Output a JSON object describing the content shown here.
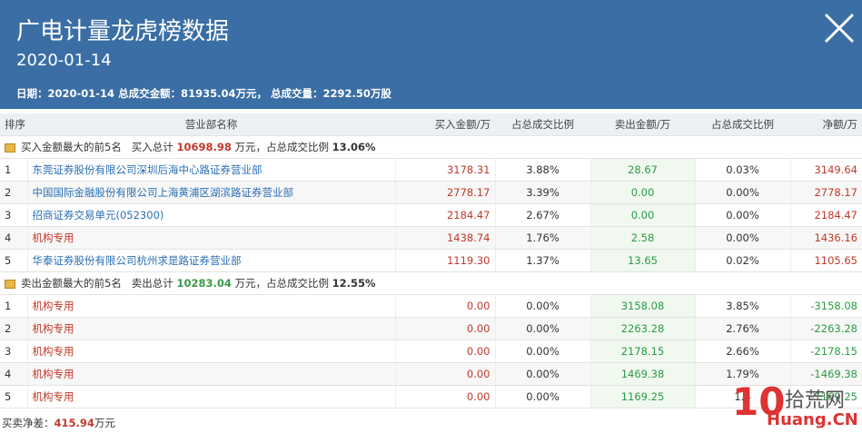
{
  "header": {
    "title": "广电计量龙虎榜数据",
    "date": "2020-01-14",
    "summary": "日期：2020-01-14 总成交金额：81935.04万元， 总成交量：2292.50万股"
  },
  "columns": [
    "排序",
    "营业部名称",
    "买入金额/万",
    "占总成交比例",
    "卖出金额/万",
    "占总成交比例",
    "净额/万"
  ],
  "buy_section": {
    "label": "买入金额最大的前5名",
    "total_prefix": "买入总计",
    "total": "10698.98",
    "total_suffix": "万元，占总成交比例",
    "ratio": "13.06%"
  },
  "buy_rows": [
    {
      "rank": "1",
      "name": "东莞证券股份有限公司深圳后海中心路证券营业部",
      "buy": "3178.31",
      "buy_pct": "3.88%",
      "sell": "28.67",
      "sell_pct": "0.03%",
      "net": "3149.64"
    },
    {
      "rank": "2",
      "name": "中国国际金融股份有限公司上海黄浦区湖滨路证券营业部",
      "buy": "2778.17",
      "buy_pct": "3.39%",
      "sell": "0.00",
      "sell_pct": "0.00%",
      "net": "2778.17"
    },
    {
      "rank": "3",
      "name": "招商证券交易单元(052300)",
      "buy": "2184.47",
      "buy_pct": "2.67%",
      "sell": "0.00",
      "sell_pct": "0.00%",
      "net": "2184.47"
    },
    {
      "rank": "4",
      "name": "机构专用",
      "buy": "1438.74",
      "buy_pct": "1.76%",
      "sell": "2.58",
      "sell_pct": "0.00%",
      "net": "1436.16"
    },
    {
      "rank": "5",
      "name": "华泰证券股份有限公司杭州求是路证券营业部",
      "buy": "1119.30",
      "buy_pct": "1.37%",
      "sell": "13.65",
      "sell_pct": "0.02%",
      "net": "1105.65"
    }
  ],
  "sell_section": {
    "label": "卖出金额最大的前5名",
    "total_prefix": "卖出总计",
    "total": "10283.04",
    "total_suffix": "万元，占总成交比例",
    "ratio": "12.55%"
  },
  "sell_rows": [
    {
      "rank": "1",
      "name": "机构专用",
      "buy": "0.00",
      "buy_pct": "0.00%",
      "sell": "3158.08",
      "sell_pct": "3.85%",
      "net": "-3158.08"
    },
    {
      "rank": "2",
      "name": "机构专用",
      "buy": "0.00",
      "buy_pct": "0.00%",
      "sell": "2263.28",
      "sell_pct": "2.76%",
      "net": "-2263.28"
    },
    {
      "rank": "3",
      "name": "机构专用",
      "buy": "0.00",
      "buy_pct": "0.00%",
      "sell": "2178.15",
      "sell_pct": "2.66%",
      "net": "-2178.15"
    },
    {
      "rank": "4",
      "name": "机构专用",
      "buy": "0.00",
      "buy_pct": "0.00%",
      "sell": "1469.38",
      "sell_pct": "1.79%",
      "net": "-1469.38"
    },
    {
      "rank": "5",
      "name": "机构专用",
      "buy": "0.00",
      "buy_pct": "0.00%",
      "sell": "1169.25",
      "sell_pct": "1.4",
      "net": "-1169.25"
    }
  ],
  "footer": {
    "label": "买卖净差：",
    "value": "415.94",
    "unit": "万元"
  },
  "watermark": {
    "num": "10",
    "cn": "拾荒网",
    "en": "Huang.CN"
  },
  "colors": {
    "header_bg": "#3a6ea5",
    "buy": "#c0392b",
    "sell": "#2e9a46",
    "link": "#2a6fb5"
  }
}
